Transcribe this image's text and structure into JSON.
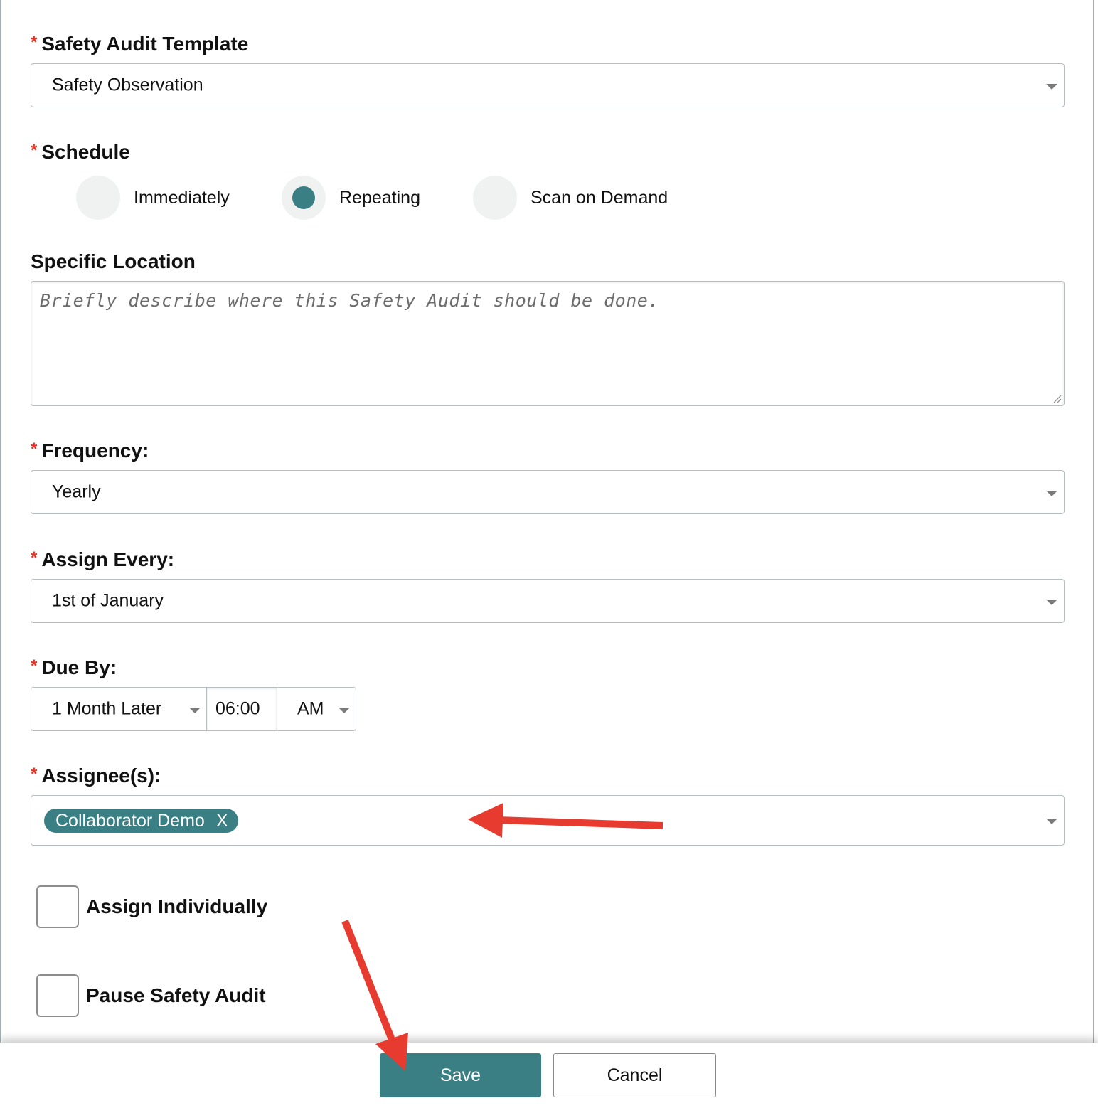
{
  "form": {
    "template": {
      "label": "Safety Audit Template",
      "value": "Safety Observation"
    },
    "schedule": {
      "label": "Schedule",
      "options": [
        "Immediately",
        "Repeating",
        "Scan on Demand"
      ],
      "selected": "Repeating"
    },
    "location": {
      "label": "Specific Location",
      "placeholder": "Briefly describe where this Safety Audit should be done."
    },
    "frequency": {
      "label": "Frequency:",
      "value": "Yearly"
    },
    "assign_every": {
      "label": "Assign Every:",
      "value": "1st of January"
    },
    "due_by": {
      "label": "Due By:",
      "offset": "1 Month Later",
      "time": "06:00",
      "period": "AM"
    },
    "assignees": {
      "label": "Assignee(s):",
      "tags": [
        {
          "name": "Collaborator Demo",
          "remove": "X"
        }
      ]
    },
    "assign_individually": {
      "label": "Assign Individually",
      "checked": false
    },
    "pause": {
      "label": "Pause Safety Audit",
      "checked": false
    },
    "required_marker": "*"
  },
  "footer": {
    "save_label": "Save",
    "cancel_label": "Cancel"
  },
  "colors": {
    "accent": "#3a7f83",
    "required": "#e53222",
    "annotation": "#e63b2e"
  }
}
